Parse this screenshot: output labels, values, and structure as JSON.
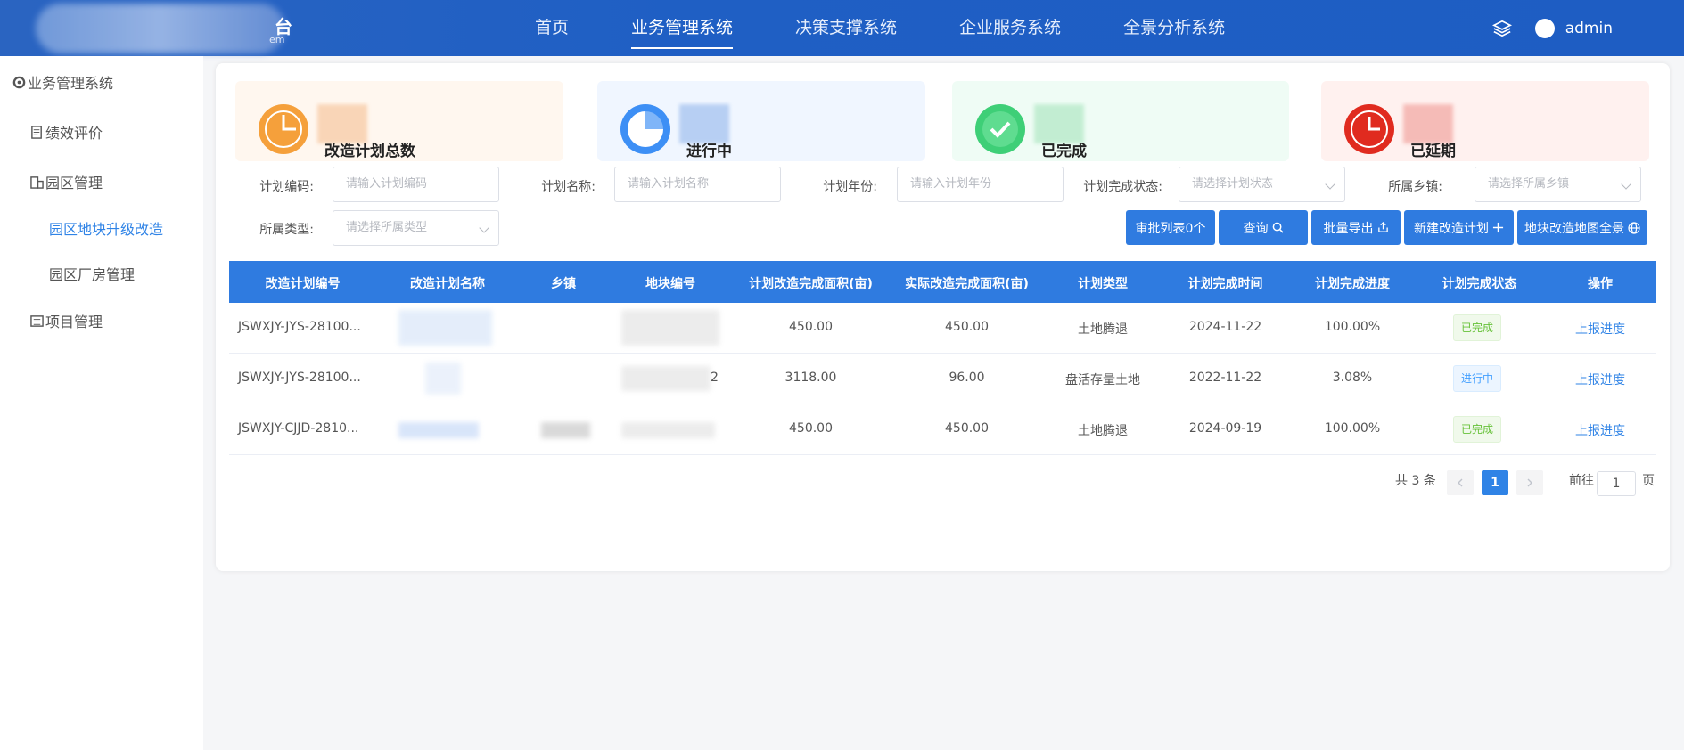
{
  "header": {
    "logo_tail": "台",
    "logo_sub": "em",
    "nav": [
      {
        "label": "首页",
        "active": false
      },
      {
        "label": "业务管理系统",
        "active": true
      },
      {
        "label": "决策支撑系统",
        "active": false
      },
      {
        "label": "企业服务系统",
        "active": false
      },
      {
        "label": "全景分析系统",
        "active": false
      }
    ],
    "user": "admin",
    "layers_icon": "layers-icon"
  },
  "sidebar": {
    "title": "业务管理系统",
    "items": [
      {
        "label": "绩效评价",
        "icon": "document-icon"
      },
      {
        "label": "园区管理",
        "icon": "building-icon"
      },
      {
        "label": "园区地块升级改造",
        "active": true
      },
      {
        "label": "园区厂房管理"
      },
      {
        "label": "项目管理",
        "icon": "list-icon"
      }
    ]
  },
  "stats": [
    {
      "label": "改造计划总数",
      "color": "#f5a03b"
    },
    {
      "label": "进行中",
      "color": "#3d8ff5"
    },
    {
      "label": "已完成",
      "color": "#3ecf77"
    },
    {
      "label": "已延期",
      "color": "#e02b1f"
    }
  ],
  "filters": {
    "plan_code": {
      "label": "计划编码:",
      "placeholder": "请输入计划编码"
    },
    "plan_name": {
      "label": "计划名称:",
      "placeholder": "请输入计划名称"
    },
    "plan_year": {
      "label": "计划年份:",
      "placeholder": "请输入计划年份"
    },
    "plan_status": {
      "label": "计划完成状态:",
      "placeholder": "请选择计划状态"
    },
    "town": {
      "label": "所属乡镇:",
      "placeholder": "请选择所属乡镇"
    },
    "type": {
      "label": "所属类型:",
      "placeholder": "请选择所属类型"
    }
  },
  "buttons": {
    "approve_list": "审批列表0个",
    "query": "查询",
    "batch_export": "批量导出",
    "new_plan": "新建改造计划",
    "map_view": "地块改造地图全景"
  },
  "table": {
    "columns": [
      "改造计划编号",
      "改造计划名称",
      "乡镇",
      "地块编号",
      "计划改造完成面积(亩)",
      "实际改造完成面积(亩)",
      "计划类型",
      "计划完成时间",
      "计划完成进度",
      "计划完成状态",
      "操作"
    ],
    "rows": [
      {
        "code": "JSWXJY-JYS-28100...",
        "plot_tail": "",
        "planned_area": "450.00",
        "actual_area": "450.00",
        "type": "土地腾退",
        "date": "2024-11-22",
        "progress": "100.00%",
        "status": "已完成",
        "status_kind": "done",
        "action": "上报进度"
      },
      {
        "code": "JSWXJY-JYS-28100...",
        "plot_tail": "2",
        "planned_area": "3118.00",
        "actual_area": "96.00",
        "type": "盘活存量土地",
        "date": "2022-11-22",
        "progress": "3.08%",
        "status": "进行中",
        "status_kind": "prog",
        "action": "上报进度"
      },
      {
        "code": "JSWXJY-CJJD-2810...",
        "plot_tail": "",
        "planned_area": "450.00",
        "actual_area": "450.00",
        "type": "土地腾退",
        "date": "2024-09-19",
        "progress": "100.00%",
        "status": "已完成",
        "status_kind": "done",
        "action": "上报进度"
      }
    ]
  },
  "pagination": {
    "total": "共 3 条",
    "current": "1",
    "goto_label": "前往",
    "goto_value": "1",
    "page_suffix": "页"
  }
}
